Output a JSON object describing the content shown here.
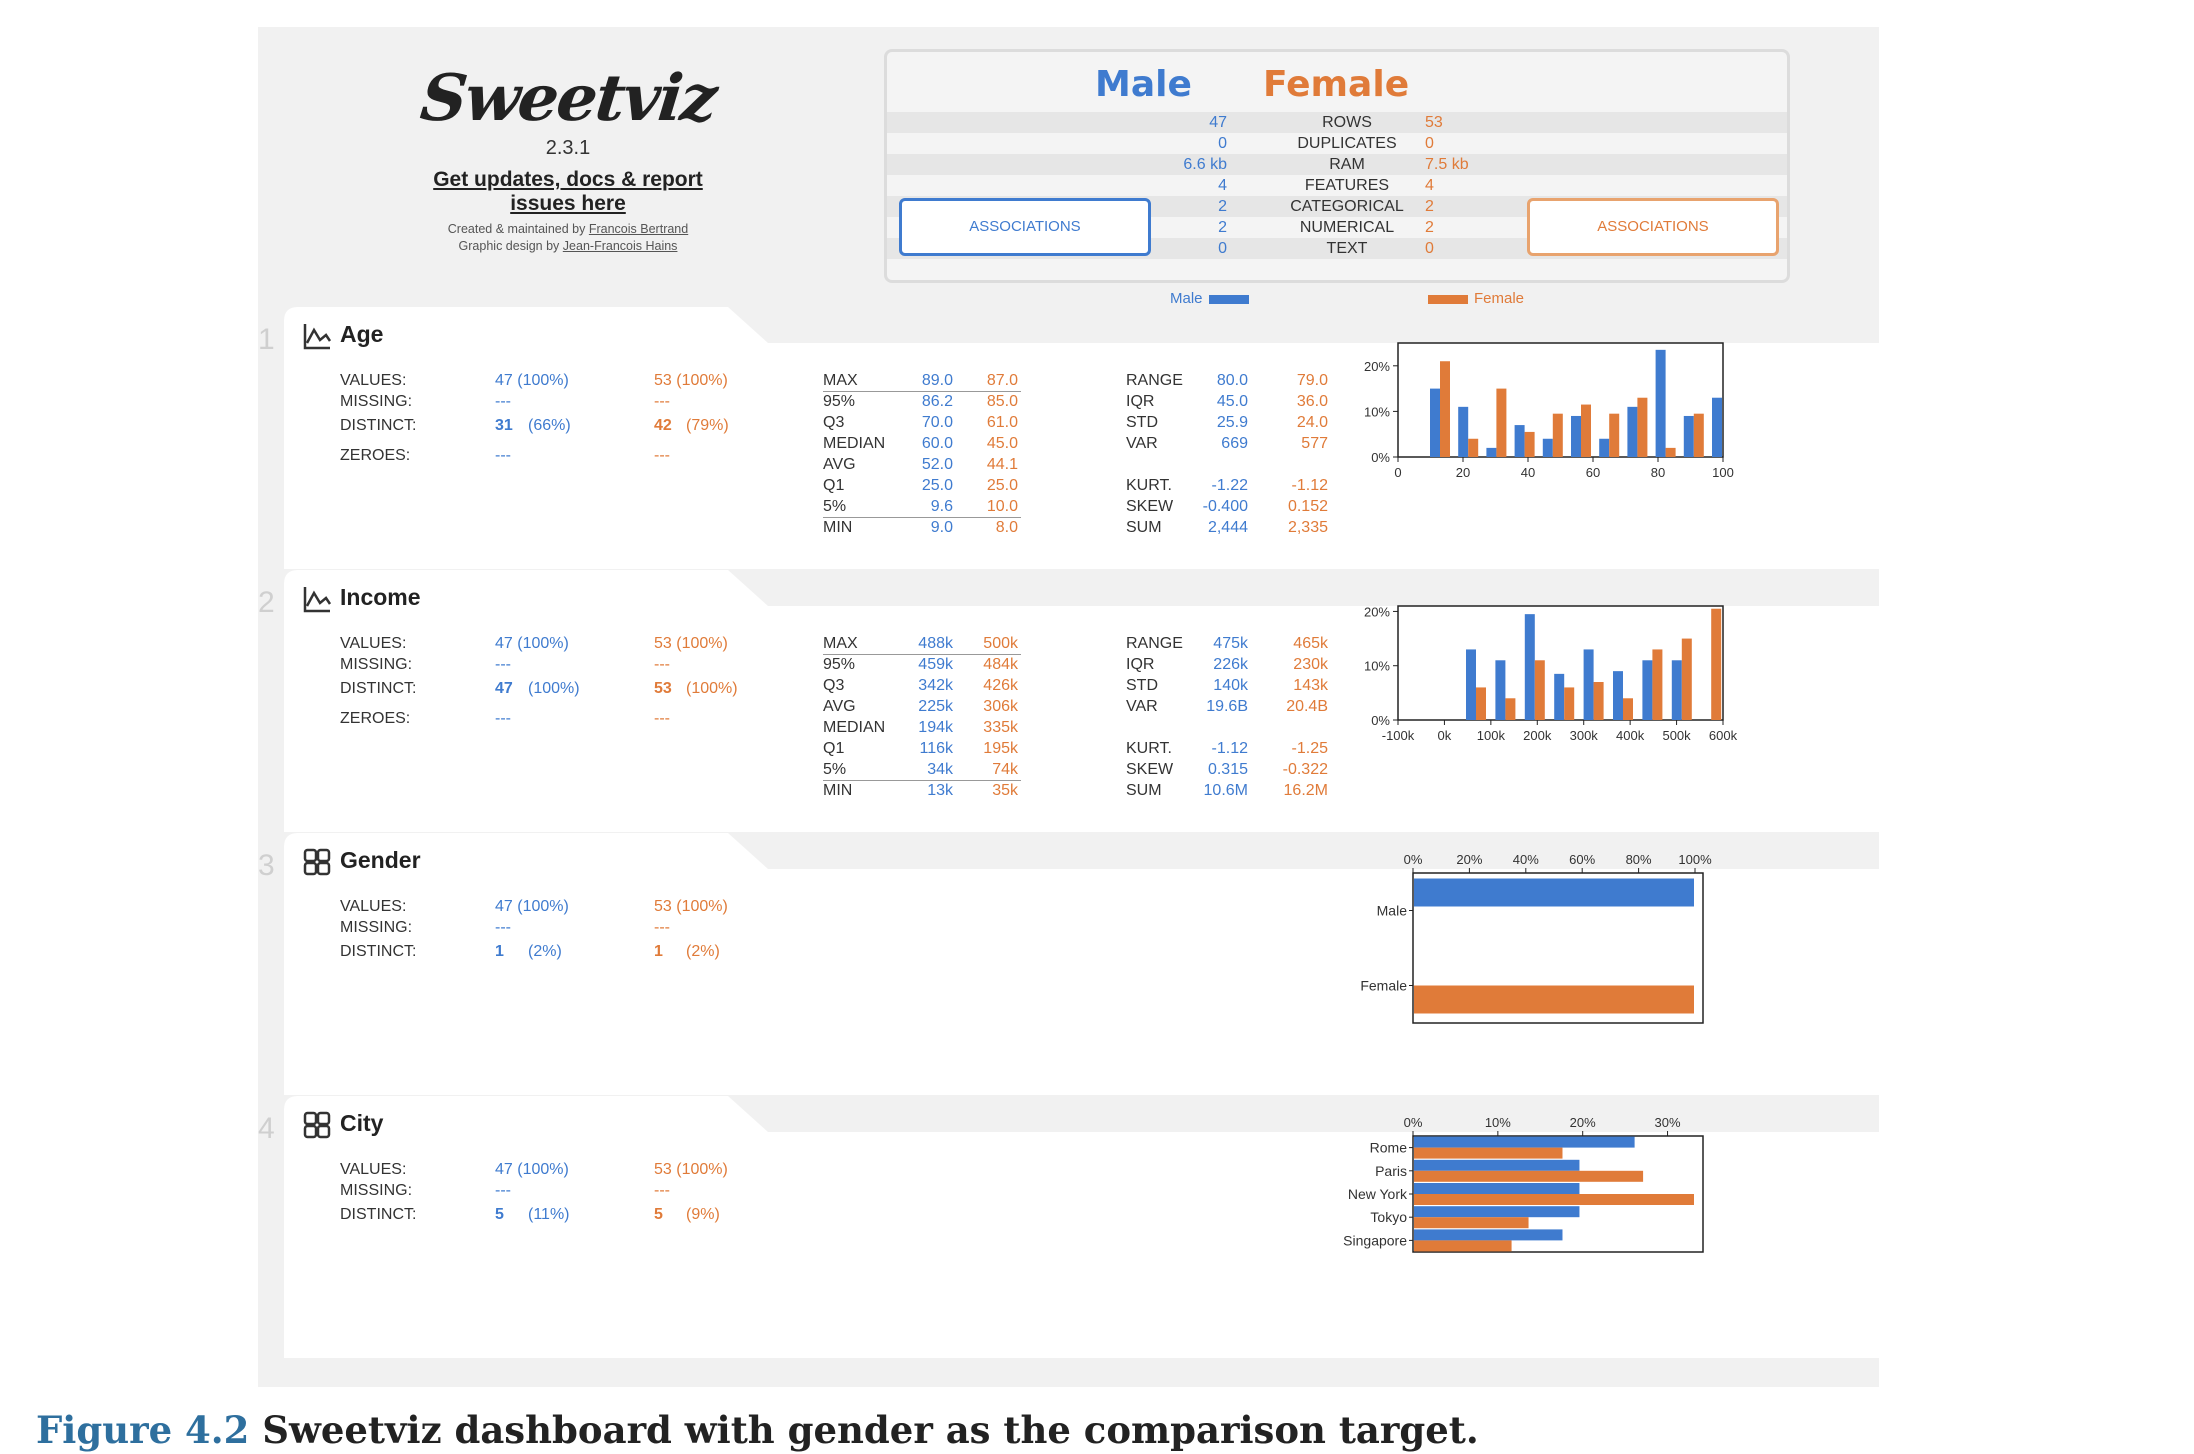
{
  "header": {
    "logo": "Sweetviz",
    "version": "2.3.1",
    "updates_link": "Get updates, docs & report issues here",
    "created_by": "Created & maintained by",
    "created_name": "Francois Bertrand",
    "design_by": "Graphic design by",
    "design_name": "Jean-Francois Hains"
  },
  "summary": {
    "male_title": "Male",
    "female_title": "Female",
    "rows": [
      {
        "label": "ROWS",
        "male": "47",
        "female": "53"
      },
      {
        "label": "DUPLICATES",
        "male": "0",
        "female": "0"
      },
      {
        "label": "RAM",
        "male": "6.6 kb",
        "female": "7.5 kb"
      },
      {
        "label": "FEATURES",
        "male": "4",
        "female": "4"
      },
      {
        "label": "CATEGORICAL",
        "male": "2",
        "female": "2"
      },
      {
        "label": "NUMERICAL",
        "male": "2",
        "female": "2"
      },
      {
        "label": "TEXT",
        "male": "0",
        "female": "0"
      }
    ],
    "assoc_male": "ASSOCIATIONS",
    "assoc_female": "ASSOCIATIONS",
    "legend_male": "Male",
    "legend_female": "Female"
  },
  "colors": {
    "male": "#3f7bcf",
    "female": "#e07b39"
  },
  "sections": [
    {
      "num": "1",
      "title": "Age",
      "icon": "line-chart-icon",
      "values_label": "VALUES:",
      "missing_label": "MISSING:",
      "distinct_label": "DISTINCT:",
      "zeroes_label": "ZEROES:",
      "values_m": "47 (100%)",
      "values_f": "53 (100%)",
      "missing_m": "---",
      "missing_f": "---",
      "distinct_m": "31",
      "distinct_m_pct": "(66%)",
      "distinct_f": "42",
      "distinct_f_pct": "(79%)",
      "zeroes_m": "---",
      "zeroes_f": "---",
      "stats1": [
        {
          "l": "MAX",
          "m": "89.0",
          "f": "87.0"
        },
        {
          "l": "95%",
          "m": "86.2",
          "f": "85.0"
        },
        {
          "l": "Q3",
          "m": "70.0",
          "f": "61.0"
        },
        {
          "l": "MEDIAN",
          "m": "60.0",
          "f": "45.0"
        },
        {
          "l": "AVG",
          "m": "52.0",
          "f": "44.1"
        },
        {
          "l": "Q1",
          "m": "25.0",
          "f": "25.0"
        },
        {
          "l": "5%",
          "m": "9.6",
          "f": "10.0"
        },
        {
          "l": "MIN",
          "m": "9.0",
          "f": "8.0"
        }
      ],
      "stats2a": [
        {
          "l": "RANGE",
          "m": "80.0",
          "f": "79.0"
        },
        {
          "l": "IQR",
          "m": "45.0",
          "f": "36.0"
        },
        {
          "l": "STD",
          "m": "25.9",
          "f": "24.0"
        },
        {
          "l": "VAR",
          "m": "669",
          "f": "577"
        }
      ],
      "stats2b": [
        {
          "l": "KURT.",
          "m": "-1.22",
          "f": "-1.12"
        },
        {
          "l": "SKEW",
          "m": "-0.400",
          "f": "0.152"
        },
        {
          "l": "SUM",
          "m": "2,444",
          "f": "2,335"
        }
      ]
    },
    {
      "num": "2",
      "title": "Income",
      "icon": "line-chart-icon",
      "values_label": "VALUES:",
      "missing_label": "MISSING:",
      "distinct_label": "DISTINCT:",
      "zeroes_label": "ZEROES:",
      "values_m": "47 (100%)",
      "values_f": "53 (100%)",
      "missing_m": "---",
      "missing_f": "---",
      "distinct_m": "47",
      "distinct_m_pct": "(100%)",
      "distinct_f": "53",
      "distinct_f_pct": "(100%)",
      "zeroes_m": "---",
      "zeroes_f": "---",
      "stats1": [
        {
          "l": "MAX",
          "m": "488k",
          "f": "500k"
        },
        {
          "l": "95%",
          "m": "459k",
          "f": "484k"
        },
        {
          "l": "Q3",
          "m": "342k",
          "f": "426k"
        },
        {
          "l": "AVG",
          "m": "225k",
          "f": "306k"
        },
        {
          "l": "MEDIAN",
          "m": "194k",
          "f": "335k"
        },
        {
          "l": "Q1",
          "m": "116k",
          "f": "195k"
        },
        {
          "l": "5%",
          "m": "34k",
          "f": "74k"
        },
        {
          "l": "MIN",
          "m": "13k",
          "f": "35k"
        }
      ],
      "stats2a": [
        {
          "l": "RANGE",
          "m": "475k",
          "f": "465k"
        },
        {
          "l": "IQR",
          "m": "226k",
          "f": "230k"
        },
        {
          "l": "STD",
          "m": "140k",
          "f": "143k"
        },
        {
          "l": "VAR",
          "m": "19.6B",
          "f": "20.4B"
        }
      ],
      "stats2b": [
        {
          "l": "KURT.",
          "m": "-1.12",
          "f": "-1.25"
        },
        {
          "l": "SKEW",
          "m": "0.315",
          "f": "-0.322"
        },
        {
          "l": "SUM",
          "m": "10.6M",
          "f": "16.2M"
        }
      ]
    },
    {
      "num": "3",
      "title": "Gender",
      "icon": "category-grid-icon",
      "values_label": "VALUES:",
      "missing_label": "MISSING:",
      "distinct_label": "DISTINCT:",
      "values_m": "47 (100%)",
      "values_f": "53 (100%)",
      "missing_m": "---",
      "missing_f": "---",
      "distinct_m": "1",
      "distinct_m_pct": "(2%)",
      "distinct_f": "1",
      "distinct_f_pct": "(2%)"
    },
    {
      "num": "4",
      "title": "City",
      "icon": "category-grid-icon",
      "values_label": "VALUES:",
      "missing_label": "MISSING:",
      "distinct_label": "DISTINCT:",
      "values_m": "47 (100%)",
      "values_f": "53 (100%)",
      "missing_m": "---",
      "missing_f": "---",
      "distinct_m": "5",
      "distinct_m_pct": "(11%)",
      "distinct_f": "5",
      "distinct_f_pct": "(9%)"
    }
  ],
  "chart_data": [
    {
      "type": "bar",
      "title": "Age",
      "x": [
        10,
        15,
        20,
        25,
        30,
        35,
        40,
        45,
        50,
        55,
        60,
        65,
        70,
        75,
        80,
        85
      ],
      "xlim": [
        0,
        100
      ],
      "ylim": [
        0,
        25
      ],
      "xticks": [
        "0",
        "20",
        "40",
        "60",
        "80",
        "100"
      ],
      "yticks": [
        "0%",
        "10%",
        "20%"
      ],
      "series": [
        {
          "name": "Male",
          "values": [
            15,
            11,
            2,
            7,
            4,
            9,
            4,
            11,
            23.5,
            9,
            13
          ]
        },
        {
          "name": "Female",
          "values": [
            21,
            4,
            15,
            5.5,
            9.5,
            11.5,
            9.5,
            13,
            2,
            9.5
          ]
        }
      ]
    },
    {
      "type": "bar",
      "title": "Income",
      "xlim": [
        -100,
        600
      ],
      "ylim": [
        0,
        21
      ],
      "xticks": [
        "-100k",
        "0k",
        "100k",
        "200k",
        "300k",
        "400k",
        "500k",
        "600k"
      ],
      "yticks": [
        "0%",
        "10%",
        "20%"
      ],
      "series": [
        {
          "name": "Male",
          "values": [
            13,
            11,
            19.5,
            8.5,
            13,
            9,
            11,
            11
          ]
        },
        {
          "name": "Female",
          "values": [
            6,
            4,
            11,
            6,
            7,
            4,
            13,
            15,
            20.5
          ]
        }
      ]
    },
    {
      "type": "bar",
      "orientation": "horizontal",
      "title": "Gender",
      "categories": [
        "Male",
        "Female"
      ],
      "xticks": [
        "0%",
        "20%",
        "40%",
        "60%",
        "80%",
        "100%"
      ],
      "xlim": [
        0,
        100
      ],
      "series": [
        {
          "name": "Male",
          "values": [
            100,
            0
          ]
        },
        {
          "name": "Female",
          "values": [
            0,
            100
          ]
        }
      ]
    },
    {
      "type": "bar",
      "orientation": "horizontal",
      "title": "City",
      "categories": [
        "Rome",
        "Paris",
        "New York",
        "Tokyo",
        "Singapore"
      ],
      "xticks": [
        "0%",
        "10%",
        "20%",
        "30%"
      ],
      "xlim": [
        0,
        33
      ],
      "series": [
        {
          "name": "Male",
          "values": [
            26,
            19.5,
            19.5,
            19.5,
            17.5
          ]
        },
        {
          "name": "Female",
          "values": [
            17.5,
            27,
            33,
            13.5,
            11.5
          ]
        }
      ]
    }
  ],
  "caption": {
    "fig": "Figure 4.2",
    "text": " Sweetviz dashboard with gender as the comparison target."
  }
}
